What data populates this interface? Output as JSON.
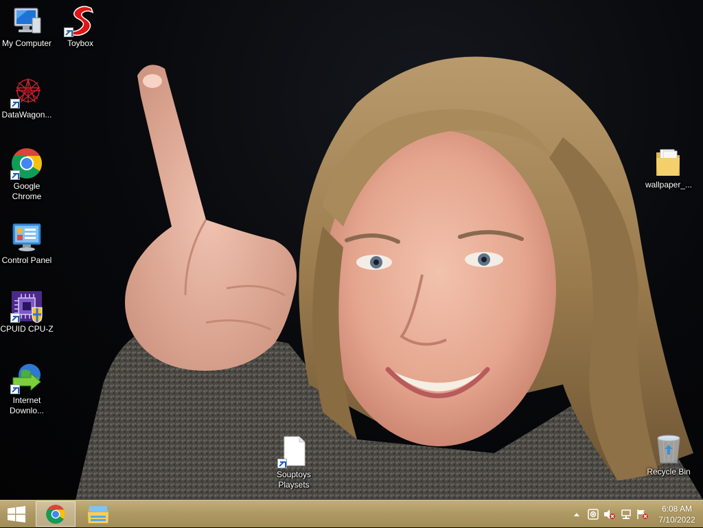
{
  "desktop": {
    "icons": [
      {
        "label": "My Computer"
      },
      {
        "label": "Toybox"
      },
      {
        "label": "DataWagon..."
      },
      {
        "label": "Google Chrome"
      },
      {
        "label": "Control Panel"
      },
      {
        "label": "CPUID CPU-Z"
      },
      {
        "label": "Internet Downlo..."
      },
      {
        "label": "Souptoys Playsets"
      },
      {
        "label": "wallpaper_..."
      },
      {
        "label": "Recycle Bin"
      }
    ]
  },
  "taskbar": {
    "pinned": [
      {
        "name": "Google Chrome",
        "icon": "chrome-icon",
        "active": true
      },
      {
        "name": "File Explorer",
        "icon": "folder-icon",
        "active": false
      }
    ],
    "tray": {
      "icons": [
        "chevron-up-icon",
        "network-adapter-icon",
        "volume-muted-icon",
        "ethernet-icon",
        "action-center-icon"
      ],
      "time": "6:08 AM",
      "date": "7/10/2022"
    }
  },
  "colors": {
    "taskbar": "#ad9863",
    "chrome_red": "#db4437",
    "chrome_yellow": "#f4c20d",
    "chrome_green": "#0f9d58",
    "chrome_blue": "#4285f4"
  }
}
